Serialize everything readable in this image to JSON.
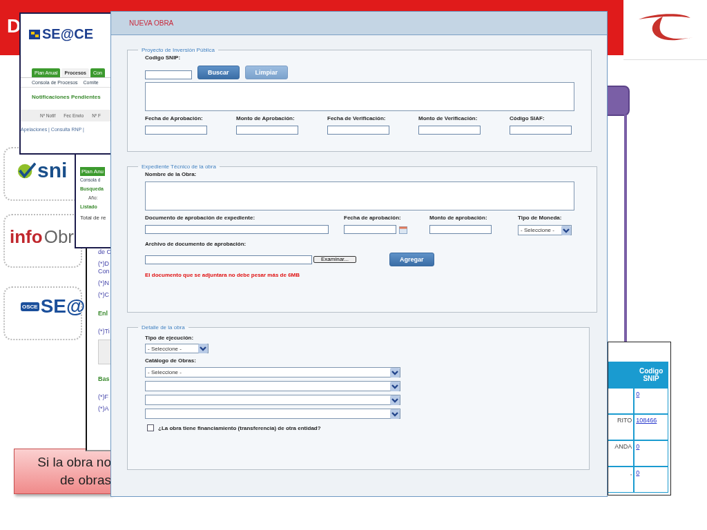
{
  "slide": {
    "title": "D",
    "callout_lines": [
      "Si la obra no",
      "de obras"
    ]
  },
  "logos": [
    {
      "kind": "sni",
      "text": "sni"
    },
    {
      "kind": "info",
      "parts": [
        "info",
        "Obr"
      ]
    },
    {
      "kind": "seace",
      "badge": "OSCE",
      "text": "SE@"
    }
  ],
  "back_window_1": {
    "logo": "SE@CE",
    "tabs": [
      {
        "label": "Plan Anual",
        "selected": false
      },
      {
        "label": "Procesos",
        "selected": true
      },
      {
        "label": "Con",
        "selected": false
      }
    ],
    "subnav": [
      "Consola de Procesos",
      "Comite"
    ],
    "heading": "Notificaciones Pendientes",
    "columns": [
      "Nº Notif",
      "Fec Envio",
      "Nº F"
    ],
    "footer": "Apelaciones | Consulta RNP |"
  },
  "back_window_2": {
    "tab": "Plan Anu",
    "subnav": "Consola d",
    "heading": "Busqueda",
    "field_label": "Año:",
    "listing": "Listado",
    "total": "Total de re"
  },
  "back_window_3": {
    "items": [
      {
        "kind": "label",
        "text": "de C"
      },
      {
        "kind": "label",
        "text": "(*)D Con"
      },
      {
        "kind": "label",
        "text": "(*)N"
      },
      {
        "kind": "label",
        "text": "(*)C"
      },
      {
        "kind": "heading",
        "text": "Enl"
      },
      {
        "kind": "label",
        "text": "(*)Ti"
      },
      {
        "kind": "blank"
      },
      {
        "kind": "heading",
        "text": "Bas"
      },
      {
        "kind": "label",
        "text": "(*)F"
      },
      {
        "kind": "label",
        "text": "(*)A"
      }
    ]
  },
  "dialog": {
    "title": "NUEVA OBRA",
    "project": {
      "legend": "Proyecto de Inversión Pública",
      "snip_label": "Codigo SNIP:",
      "buttons": [
        {
          "label": "Buscar",
          "disabled": false
        },
        {
          "label": "Limpiar",
          "disabled": true
        }
      ],
      "fields": [
        "Fecha de Aprobación:",
        "Monto de Aprobación:",
        "Fecha de Verificación:",
        "Monto de Verificación:",
        "Código SIAF:"
      ]
    },
    "technical": {
      "legend": "Expediente Técnico de la obra",
      "name_label": "Nombre de la Obra:",
      "doc_label": "Documento de aprobación de expediente:",
      "date_label": "Fecha de aprobación:",
      "amount_label": "Monto de aprobación:",
      "currency_label": "Tipo de Moneda:",
      "currency_value": "- Seleccione -",
      "file_label": "Archivo de documento de aprobación:",
      "browse": "Examinar...",
      "add": "Agregar",
      "note": "El documento que se adjuntara no debe pesar más de 6MB"
    },
    "detail": {
      "legend": "Detalle de la obra",
      "exec_label": "Tipo de ejecución:",
      "exec_value": "- Seleccione -",
      "catalog_label": "Catálogo de Obras:",
      "catalog_selects": [
        {
          "kind": "filled",
          "value": "- Seleccione -"
        },
        {
          "kind": "blank"
        },
        {
          "kind": "blank"
        },
        {
          "kind": "blank"
        }
      ],
      "financing": {
        "label": "¿La obra tiene financiamiento (transferencia) de otra entidad?",
        "checked": false
      }
    }
  },
  "side_table": {
    "columns": [
      "Codigo SNIP"
    ],
    "rows": [
      {
        "snip": "0"
      },
      {
        "column_1": "RITO",
        "snip": "108466"
      },
      {
        "column_1": "ANDA",
        "snip": "0"
      },
      {
        "column_1": ",",
        "snip": "0"
      }
    ]
  }
}
